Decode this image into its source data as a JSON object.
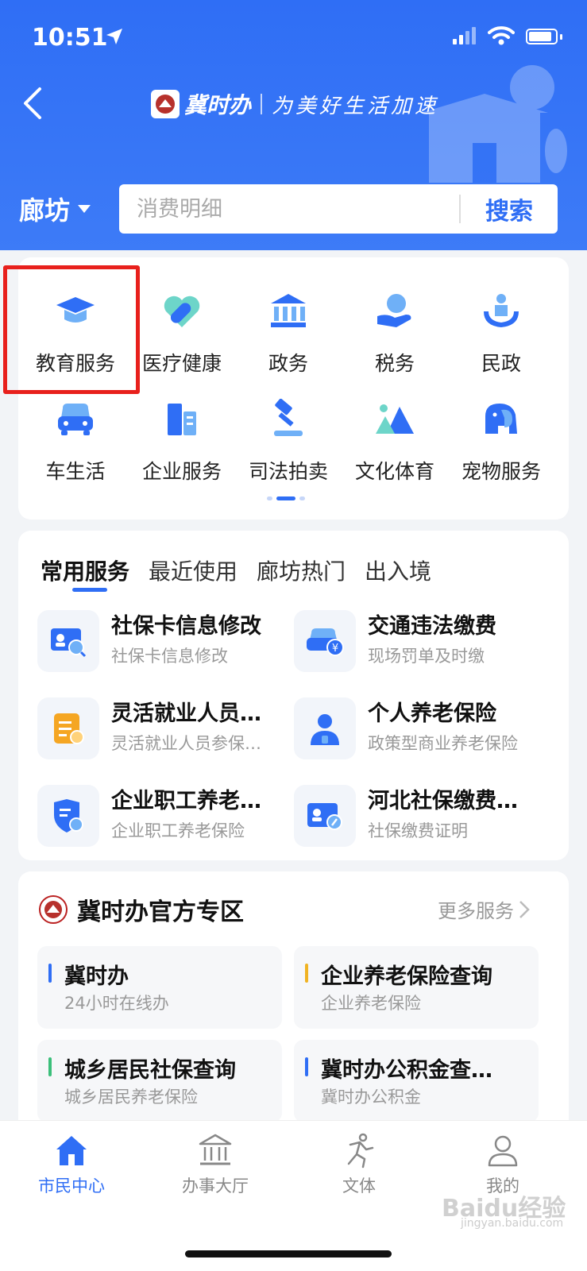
{
  "status_bar": {
    "time": "10:51"
  },
  "header": {
    "app_name": "冀时办",
    "slogan": "为美好生活加速",
    "city": "廊坊",
    "search_placeholder": "消费明细",
    "search_button": "搜索"
  },
  "grid": {
    "items": [
      {
        "label": "教育服务",
        "icon": "graduation-cap-icon"
      },
      {
        "label": "医疗健康",
        "icon": "heart-pill-icon"
      },
      {
        "label": "政务",
        "icon": "government-building-icon"
      },
      {
        "label": "税务",
        "icon": "tax-hand-icon"
      },
      {
        "label": "民政",
        "icon": "family-icon"
      },
      {
        "label": "车生活",
        "icon": "car-icon"
      },
      {
        "label": "企业服务",
        "icon": "office-building-icon"
      },
      {
        "label": "司法拍卖",
        "icon": "gavel-icon"
      },
      {
        "label": "文化体育",
        "icon": "mountain-icon"
      },
      {
        "label": "宠物服务",
        "icon": "elephant-icon"
      }
    ],
    "highlighted": "教育服务",
    "page_index": 2,
    "page_count": 3
  },
  "services": {
    "tabs": [
      "常用服务",
      "最近使用",
      "廊坊热门",
      "出入境"
    ],
    "active_tab": "常用服务",
    "items": [
      {
        "title": "社保卡信息修改",
        "subtitle": "社保卡信息修改",
        "icon": "id-card-search-icon"
      },
      {
        "title": "交通违法缴费",
        "subtitle": "现场罚单及时缴",
        "icon": "car-fine-icon"
      },
      {
        "title": "灵活就业人员…",
        "subtitle": "灵活就业人员参保…",
        "icon": "insurance-doc-icon"
      },
      {
        "title": "个人养老保险",
        "subtitle": "政策型商业养老保险",
        "icon": "person-icon"
      },
      {
        "title": "企业职工养老…",
        "subtitle": "企业职工养老保险",
        "icon": "shield-search-icon"
      },
      {
        "title": "河北社保缴费…",
        "subtitle": "社保缴费证明",
        "icon": "id-card-edit-icon"
      }
    ]
  },
  "official": {
    "title": "冀时办官方专区",
    "more": "更多服务",
    "items": [
      {
        "title": "冀时办",
        "subtitle": "24小时在线办",
        "color": "#2f6ef5"
      },
      {
        "title": "企业养老保险查询",
        "subtitle": "企业养老保险",
        "color": "#f0b323"
      },
      {
        "title": "城乡居民社保查询",
        "subtitle": "城乡居民养老保险",
        "color": "#3bbf7a"
      },
      {
        "title": "冀时办公积金查…",
        "subtitle": "冀时办公积金",
        "color": "#2f6ef5"
      }
    ]
  },
  "tabbar": {
    "items": [
      {
        "label": "市民中心",
        "active": true
      },
      {
        "label": "办事大厅",
        "active": false
      },
      {
        "label": "文体",
        "active": false
      },
      {
        "label": "我的",
        "active": false
      }
    ]
  },
  "watermark": {
    "text": "Baidu经验",
    "sub": "jingyan.baidu.com"
  },
  "colors": {
    "primary": "#2f6ef5",
    "highlight": "#e8201c"
  }
}
